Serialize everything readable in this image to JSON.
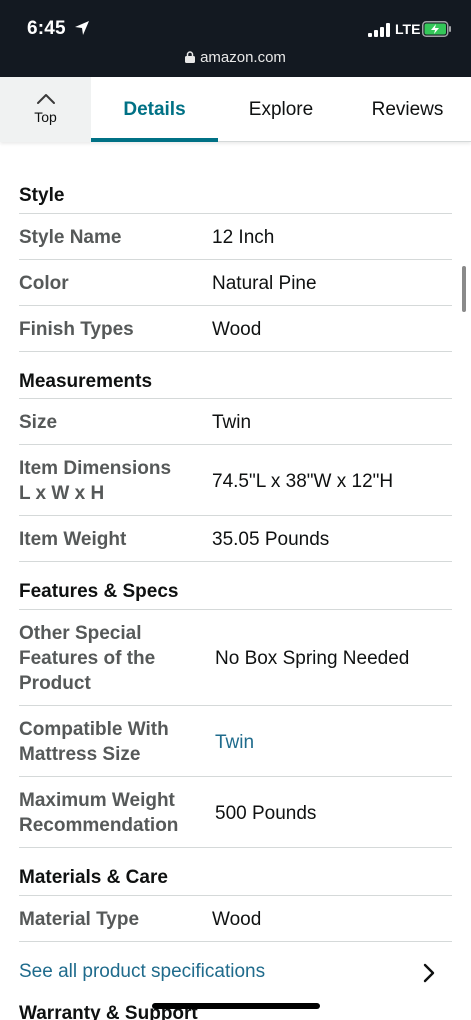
{
  "status_bar": {
    "time": "6:45",
    "network": "LTE",
    "url": "amazon.com"
  },
  "tabs": {
    "top_label": "Top",
    "items": [
      "Details",
      "Explore",
      "Reviews"
    ],
    "active": "Details"
  },
  "sections": {
    "style": {
      "title": "Style",
      "rows": [
        {
          "label": "Style Name",
          "value": "12 Inch"
        },
        {
          "label": "Color",
          "value": "Natural Pine"
        },
        {
          "label": "Finish Types",
          "value": "Wood"
        }
      ]
    },
    "measurements": {
      "title": "Measurements",
      "rows": [
        {
          "label": "Size",
          "value": "Twin"
        },
        {
          "label": "Item Dimensions L x W x H",
          "value": "74.5\"L x 38\"W x 12\"H"
        },
        {
          "label": "Item Weight",
          "value": "35.05 Pounds"
        }
      ]
    },
    "features": {
      "title": "Features & Specs",
      "rows": [
        {
          "label": "Other Special Features of the Product",
          "value": "No Box Spring Needed"
        },
        {
          "label": "Compatible With Mattress Size",
          "value": "Twin"
        },
        {
          "label": "Maximum Weight Recommendation",
          "value": "500 Pounds"
        }
      ]
    },
    "materials": {
      "title": "Materials & Care",
      "rows": [
        {
          "label": "Material Type",
          "value": "Wood"
        }
      ]
    }
  },
  "see_all": "See all product specifications",
  "next_section": "Warranty & Support",
  "colors": {
    "status_bar_bg": "#131921",
    "accent": "#007185",
    "link": "#1f6b8c",
    "label_gray": "#565959"
  }
}
